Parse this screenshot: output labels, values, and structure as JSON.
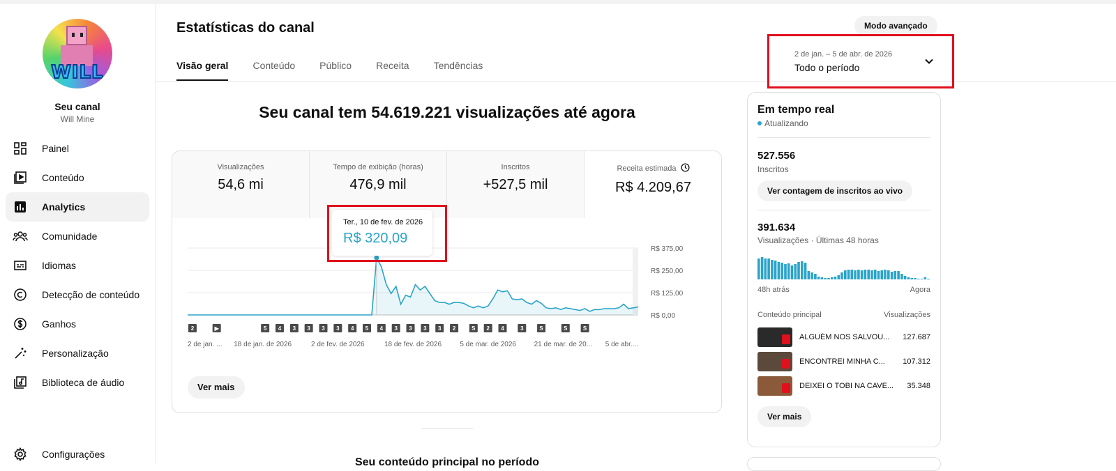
{
  "sidebar": {
    "channel_title": "Seu canal",
    "channel_name": "Will Mine",
    "avatar_text": "WILL",
    "items": [
      {
        "label": "Painel",
        "icon": "dashboard-icon"
      },
      {
        "label": "Conteúdo",
        "icon": "content-icon"
      },
      {
        "label": "Analytics",
        "icon": "analytics-icon",
        "active": true
      },
      {
        "label": "Comunidade",
        "icon": "community-icon"
      },
      {
        "label": "Idiomas",
        "icon": "subtitles-icon"
      },
      {
        "label": "Detecção de conteúdo",
        "icon": "copyright-icon"
      },
      {
        "label": "Ganhos",
        "icon": "dollar-icon"
      },
      {
        "label": "Personalização",
        "icon": "magic-wand-icon"
      },
      {
        "label": "Biblioteca de áudio",
        "icon": "audio-library-icon"
      }
    ],
    "settings_label": "Configurações"
  },
  "header": {
    "title": "Estatísticas do canal",
    "tabs": [
      "Visão geral",
      "Conteúdo",
      "Público",
      "Receita",
      "Tendências"
    ],
    "advanced_mode": "Modo avançado",
    "period_range": "2 de jan. – 5 de abr. de 2026",
    "period_label": "Todo o período"
  },
  "headline": "Seu canal tem 54.619.221 visualizações até agora",
  "metrics": [
    {
      "label": "Visualizações",
      "value": "54,6 mi"
    },
    {
      "label": "Tempo de exibição (horas)",
      "value": "476,9 mil"
    },
    {
      "label": "Inscritos",
      "value": "+527,5 mil"
    },
    {
      "label": "Receita estimada",
      "value": "R$ 4.209,67"
    }
  ],
  "tooltip": {
    "date": "Ter., 10 de fev. de 2026",
    "value": "R$ 320,09"
  },
  "chart_data": {
    "type": "area",
    "y_ticks": [
      "R$ 375,00",
      "R$ 250,00",
      "R$ 125,00",
      "R$ 0,00"
    ],
    "ylim": [
      0,
      375
    ],
    "x_ticks": [
      "2 de jan. ...",
      "18 de jan. de 2026",
      "2 de fev. de 2026",
      "18 de fev. de 2026",
      "5 de mar. de 2026",
      "21 de mar. de 20...",
      "5 de abr...."
    ],
    "x_days": 94,
    "values": [
      0,
      0,
      0,
      0,
      0,
      0,
      0,
      0,
      0,
      0,
      0,
      0,
      0,
      0,
      0,
      0,
      0,
      0,
      0,
      0,
      0,
      0,
      0,
      0,
      0,
      0,
      0,
      0,
      0,
      0,
      0,
      0,
      0,
      0,
      0,
      0,
      0,
      0,
      0,
      320,
      270,
      170,
      120,
      160,
      60,
      110,
      100,
      170,
      140,
      160,
      120,
      80,
      70,
      70,
      60,
      70,
      70,
      65,
      50,
      40,
      50,
      40,
      50,
      90,
      140,
      130,
      135,
      90,
      85,
      90,
      70,
      60,
      80,
      65,
      40,
      35,
      40,
      30,
      40,
      35,
      30,
      25,
      35,
      20,
      30,
      30,
      35,
      35,
      35,
      40,
      60,
      35,
      40,
      45
    ],
    "highlight_index": 39,
    "markers": [
      {
        "day": 1,
        "label": "2"
      },
      {
        "day": 6,
        "label": "▶"
      },
      {
        "day": 16,
        "label": "5"
      },
      {
        "day": 19,
        "label": "4"
      },
      {
        "day": 22,
        "label": "3"
      },
      {
        "day": 25,
        "label": "3"
      },
      {
        "day": 28,
        "label": "3"
      },
      {
        "day": 31,
        "label": "3"
      },
      {
        "day": 34,
        "label": "4"
      },
      {
        "day": 37,
        "label": "5"
      },
      {
        "day": 40,
        "label": "4"
      },
      {
        "day": 43,
        "label": "3"
      },
      {
        "day": 46,
        "label": "3"
      },
      {
        "day": 49,
        "label": "3"
      },
      {
        "day": 52,
        "label": "3"
      },
      {
        "day": 55,
        "label": "2"
      },
      {
        "day": 59,
        "label": "S"
      },
      {
        "day": 62,
        "label": "2"
      },
      {
        "day": 65,
        "label": "4"
      },
      {
        "day": 69,
        "label": "3"
      },
      {
        "day": 73,
        "label": "S"
      },
      {
        "day": 78,
        "label": "S"
      },
      {
        "day": 82,
        "label": "S"
      }
    ]
  },
  "chart_more": "Ver mais",
  "section2_title": "Seu conteúdo principal no período",
  "realtime": {
    "title": "Em tempo real",
    "status": "Atualizando",
    "subs_value": "527.556",
    "subs_label": "Inscritos",
    "live_button": "Ver contagem de inscritos ao vivo",
    "views_value": "391.634",
    "views_label": "Visualizações · Últimas 48 horas",
    "spark": [
      30,
      32,
      30,
      30,
      28,
      27,
      25,
      24,
      22,
      23,
      20,
      22,
      25,
      26,
      24,
      12,
      10,
      8,
      4,
      3,
      2,
      2,
      3,
      4,
      6,
      10,
      13,
      14,
      14,
      13,
      14,
      13,
      14,
      14,
      13,
      14,
      12,
      13,
      14,
      13,
      11,
      12,
      12,
      8,
      5,
      3,
      2,
      2,
      1,
      1,
      3,
      1
    ],
    "axis_left": "48h atrás",
    "axis_right": "Agora",
    "top_content_label": "Conteúdo principal",
    "top_views_label": "Visualizações",
    "rows": [
      {
        "title": "ALGUÉM NOS SALVOU...",
        "views": "127.687",
        "color": "#2a2a2a"
      },
      {
        "title": "ENCONTREI MINHA C...",
        "views": "107.312",
        "color": "#5b4a3c"
      },
      {
        "title": "DEIXEI O TOBI NA CAVE...",
        "views": "35.348",
        "color": "#8a5a3a"
      }
    ],
    "more": "Ver mais"
  },
  "colors": {
    "accent": "#2aa4c9",
    "highlight_box": "#e0101c"
  }
}
